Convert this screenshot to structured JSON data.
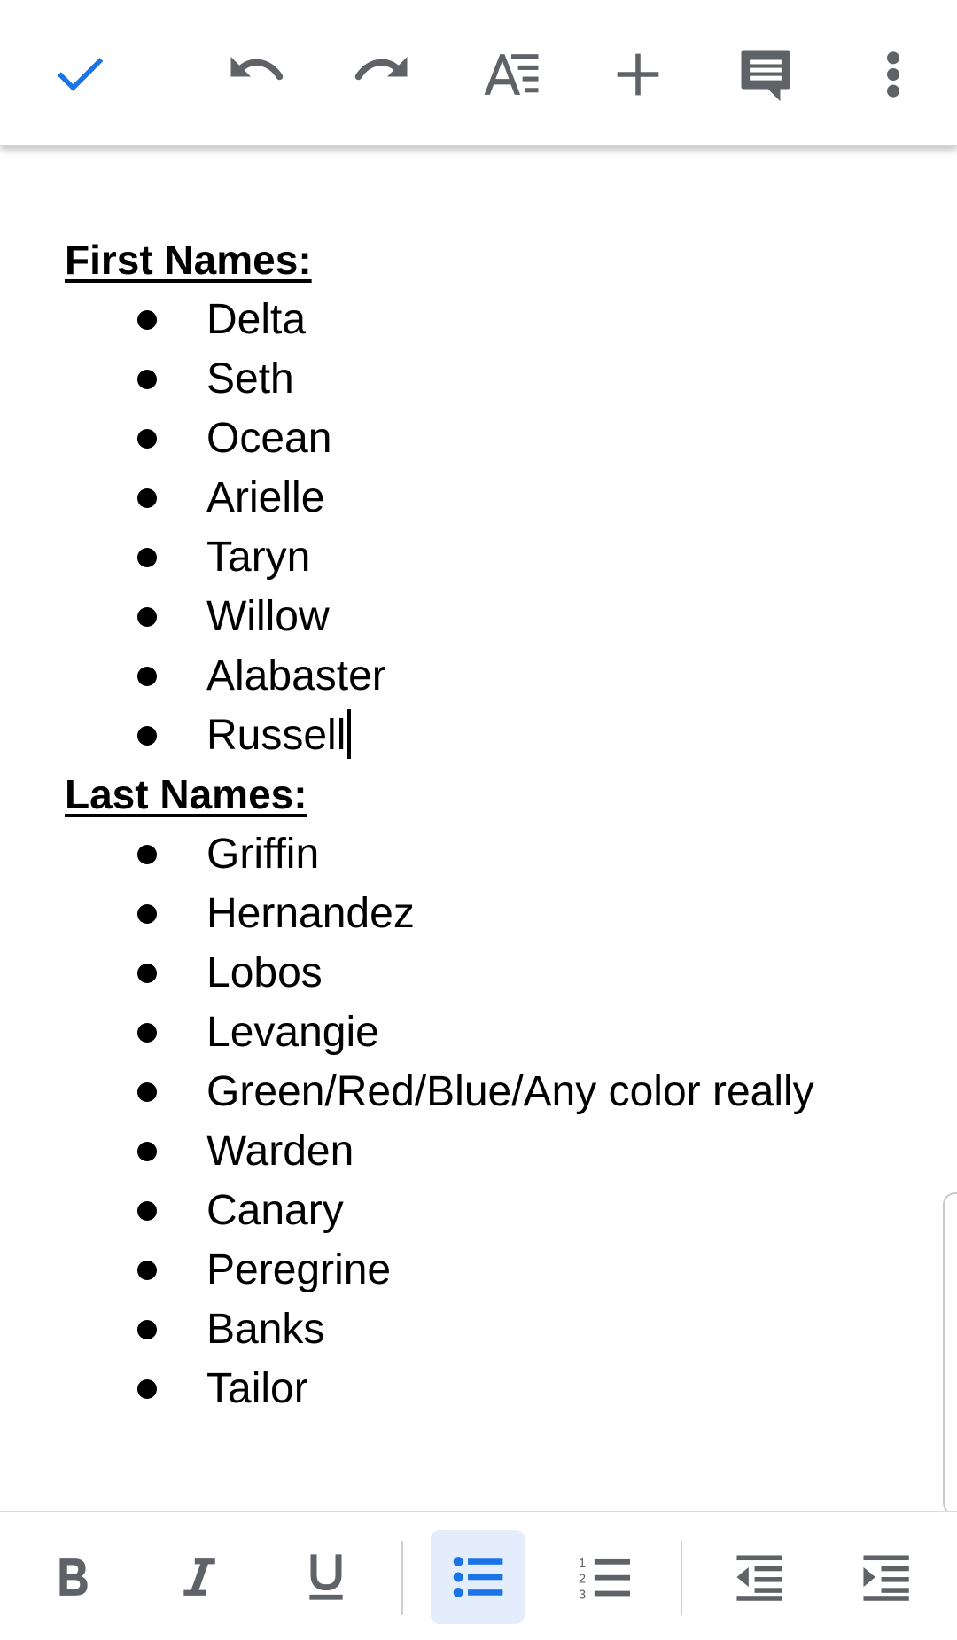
{
  "colors": {
    "accent": "#1a73e8",
    "icon": "#5f6368",
    "active_bg": "#e3edfb"
  },
  "toolbar": {
    "icons": [
      "check-icon",
      "undo-icon",
      "redo-icon",
      "text-format-icon",
      "insert-plus-icon",
      "comment-icon",
      "more-vert-icon"
    ]
  },
  "document": {
    "first_names": {
      "heading": "First Names:",
      "items": [
        "Delta",
        "Seth",
        "Ocean",
        "Arielle",
        "Taryn",
        "Willow",
        "Alabaster",
        "Russell"
      ]
    },
    "last_names": {
      "heading": "Last Names:",
      "items": [
        "Griffin",
        "Hernandez",
        "Lobos",
        "Levangie",
        "Green/Red/Blue/Any color really",
        "Warden",
        "Canary",
        "Peregrine",
        "Banks",
        "Tailor"
      ]
    }
  },
  "format_bar": {
    "icons": [
      "bold-icon",
      "italic-icon",
      "underline-icon",
      "bulleted-list-icon",
      "numbered-list-icon",
      "decrease-indent-icon",
      "increase-indent-icon"
    ],
    "active": "bulleted-list-icon"
  }
}
